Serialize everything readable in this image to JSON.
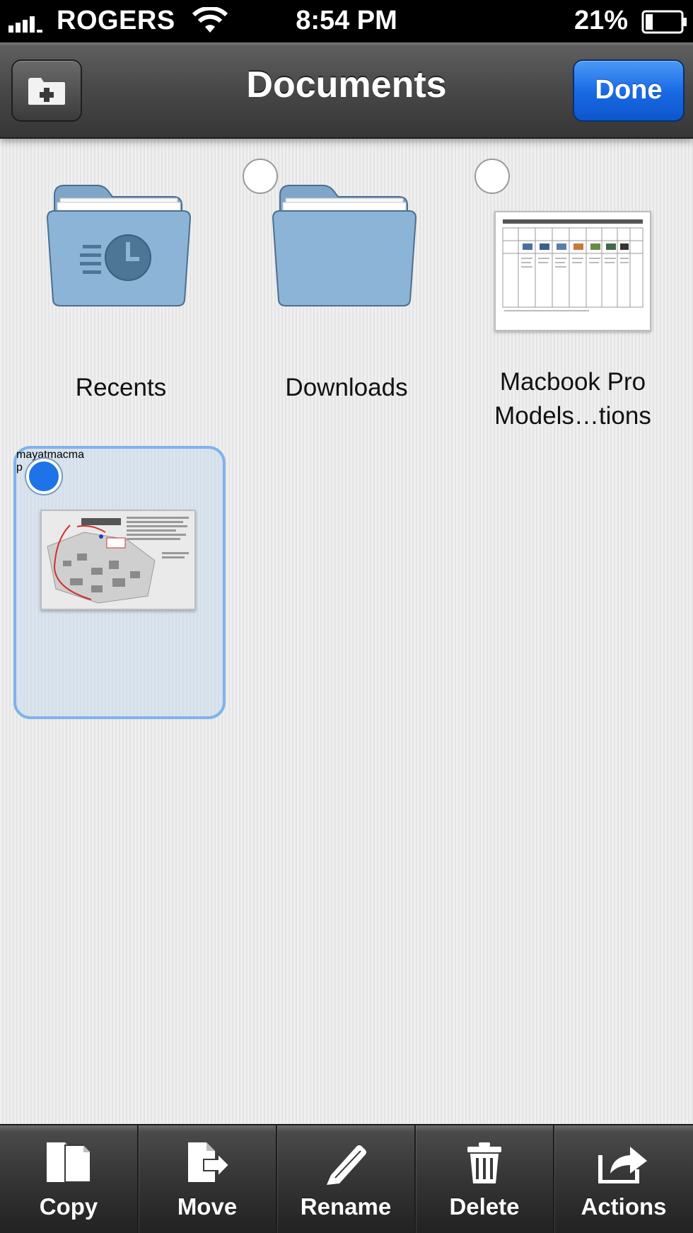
{
  "status_bar": {
    "carrier": "ROGERS",
    "time": "8:54 PM",
    "battery_percent": "21%",
    "battery_level": 0.21,
    "signal_icon": "signal-bars-icon",
    "wifi_icon": "wifi-icon",
    "battery_icon": "battery-icon"
  },
  "nav_bar": {
    "title": "Documents",
    "new_folder_icon": "folder-plus-icon",
    "done_label": "Done",
    "done_color": "#1a6be6"
  },
  "items": [
    {
      "label": "Recents",
      "kind": "folder",
      "icon": "clock-icon",
      "selectable": false
    },
    {
      "label": "Downloads",
      "kind": "folder",
      "selectable": true,
      "selected": false
    },
    {
      "label": "Macbook Pro Models…tions",
      "label_line1": "Macbook Pro",
      "label_line2": "Models…tions",
      "kind": "document",
      "thumbnail_title": "MacBook Pro Models & Specifications",
      "selectable": true,
      "selected": false
    },
    {
      "label": "mayatmacmap",
      "label_line1": "mayatmacma",
      "label_line2": "p",
      "kind": "document",
      "thumbnail_title": "Campus Map",
      "selectable": true,
      "selected": true
    }
  ],
  "selection_color": "#1e73e8",
  "toolbar": {
    "buttons": [
      {
        "label": "Copy",
        "icon": "copy-icon"
      },
      {
        "label": "Move",
        "icon": "move-icon"
      },
      {
        "label": "Rename",
        "icon": "pencil-icon"
      },
      {
        "label": "Delete",
        "icon": "trash-icon"
      },
      {
        "label": "Actions",
        "icon": "share-icon"
      }
    ]
  }
}
